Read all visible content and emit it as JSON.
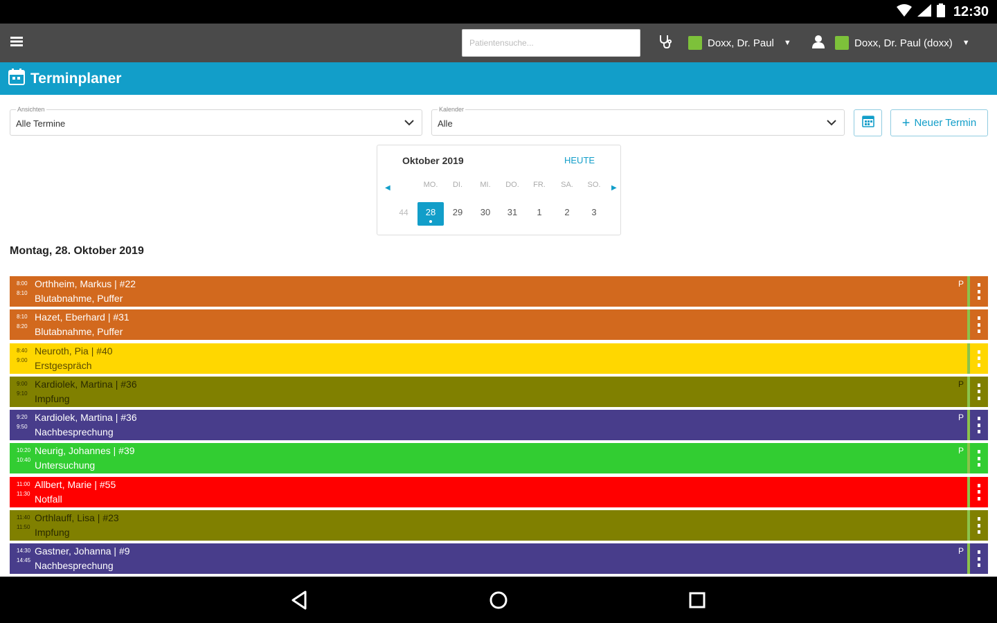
{
  "status_bar": {
    "time": "12:30"
  },
  "toolbar": {
    "search_placeholder": "Patientensuche...",
    "practitioner": "Doxx, Dr. Paul",
    "user": "Doxx, Dr. Paul (doxx)"
  },
  "page": {
    "title": "Terminplaner"
  },
  "filters": {
    "view_label": "Ansichten",
    "view_value": "Alle Termine",
    "calendar_label": "Kalender",
    "calendar_value": "Alle"
  },
  "new_appointment_label": "Neuer Termin",
  "week_picker": {
    "month": "Oktober 2019",
    "today_label": "HEUTE",
    "weekdays": [
      "MO.",
      "DI.",
      "MI.",
      "DO.",
      "FR.",
      "SA.",
      "SO."
    ],
    "week_number": "44",
    "days": [
      "28",
      "29",
      "30",
      "31",
      "1",
      "2",
      "3"
    ],
    "selected_index": 0
  },
  "date_heading": "Montag, 28. Oktober 2019",
  "appointments": [
    {
      "start": "8:00",
      "end": "8:10",
      "patient": "Orthheim, Markus | #22",
      "type": "Blutabnahme, Puffer",
      "color": "#d2691e",
      "text_color": "#ffffff",
      "flag": "P"
    },
    {
      "start": "8:10",
      "end": "8:20",
      "patient": "Hazet, Eberhard | #31",
      "type": "Blutabnahme, Puffer",
      "color": "#d2691e",
      "text_color": "#ffffff",
      "flag": ""
    },
    {
      "start": "8:40",
      "end": "9:00",
      "patient": "Neuroth, Pia | #40",
      "type": "Erstgespräch",
      "color": "#ffd700",
      "text_color": "#5a4a00",
      "flag": ""
    },
    {
      "start": "9:00",
      "end": "9:10",
      "patient": "Kardiolek, Martina | #36",
      "type": "Impfung",
      "color": "#808000",
      "text_color": "#2a2a00",
      "flag": "P"
    },
    {
      "start": "9:20",
      "end": "9:50",
      "patient": "Kardiolek, Martina | #36",
      "type": "Nachbesprechung",
      "color": "#483d8b",
      "text_color": "#ffffff",
      "flag": "P"
    },
    {
      "start": "10:20",
      "end": "10:40",
      "patient": "Neurig, Johannes | #39",
      "type": "Untersuchung",
      "color": "#32cd32",
      "text_color": "#ffffff",
      "flag": "P"
    },
    {
      "start": "11:00",
      "end": "11:30",
      "patient": "Allbert, Marie | #55",
      "type": "Notfall",
      "color": "#ff0000",
      "text_color": "#ffffff",
      "flag": ""
    },
    {
      "start": "11:40",
      "end": "11:50",
      "patient": "Orthlauff, Lisa | #23",
      "type": "Impfung",
      "color": "#808000",
      "text_color": "#2a2a00",
      "flag": ""
    },
    {
      "start": "14:30",
      "end": "14:45",
      "patient": "Gastner, Johanna | #9",
      "type": "Nachbesprechung",
      "color": "#483d8b",
      "text_color": "#ffffff",
      "flag": "P"
    }
  ]
}
